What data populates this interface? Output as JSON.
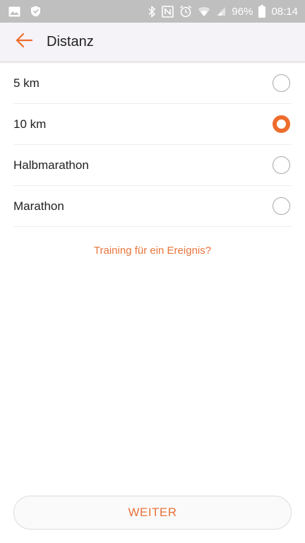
{
  "status_bar": {
    "battery": "96%",
    "time": "08:14",
    "icons": [
      "image-icon",
      "shield-icon",
      "bluetooth-icon",
      "nfc-icon",
      "alarm-icon",
      "wifi-icon",
      "signal-icon",
      "battery-icon"
    ]
  },
  "toolbar": {
    "title": "Distanz",
    "back_icon": "arrow-left-icon"
  },
  "options": [
    {
      "label": "5 km",
      "selected": false
    },
    {
      "label": "10 km",
      "selected": true
    },
    {
      "label": "Halbmarathon",
      "selected": false
    },
    {
      "label": "Marathon",
      "selected": false
    }
  ],
  "event_link": "Training für ein Ereignis?",
  "continue_label": "WEITER",
  "colors": {
    "accent": "#ee6c2c",
    "accent_text": "#e8743b",
    "status_bar": "#bfbfbf",
    "toolbar": "#f5f3f8"
  }
}
